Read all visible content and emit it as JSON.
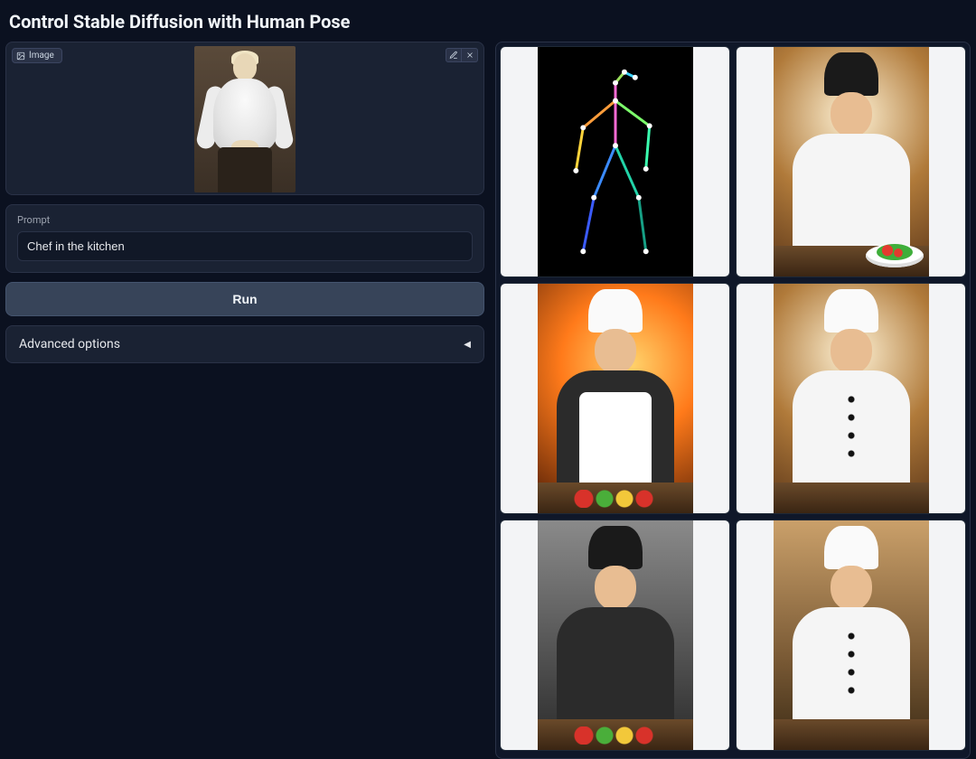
{
  "title": "Control Stable Diffusion with Human Pose",
  "image_upload": {
    "badge_label": "Image",
    "edit_tooltip": "Edit",
    "clear_tooltip": "Clear"
  },
  "prompt": {
    "label": "Prompt",
    "value": "Chef in the kitchen"
  },
  "run_button": "Run",
  "advanced": {
    "label": "Advanced options",
    "expanded": false
  },
  "gallery": {
    "items": [
      {
        "kind": "pose-skeleton",
        "alt": "detected human pose skeleton on black"
      },
      {
        "kind": "chef",
        "variant": "whitejacket darkhat plate",
        "alt": "chef in white jacket and black toque holding a plate of salad in a kitchen"
      },
      {
        "kind": "chef",
        "variant": "darkjacket fire apron veg",
        "alt": "smiling chef in dark shirt and white apron chopping vegetables with flames behind"
      },
      {
        "kind": "chef",
        "variant": "whitejacket buttons",
        "alt": "chef in white double-breasted jacket standing confidently in a restaurant kitchen"
      },
      {
        "kind": "chef",
        "variant": "darkjacket darkhat steel veg",
        "alt": "chef in dark jacket and black toque preparing vegetables at a steel counter"
      },
      {
        "kind": "chef",
        "variant": "whitejacket wood buttons",
        "alt": "chef in white jacket and tall white hat in a warm wooden kitchen"
      }
    ]
  }
}
